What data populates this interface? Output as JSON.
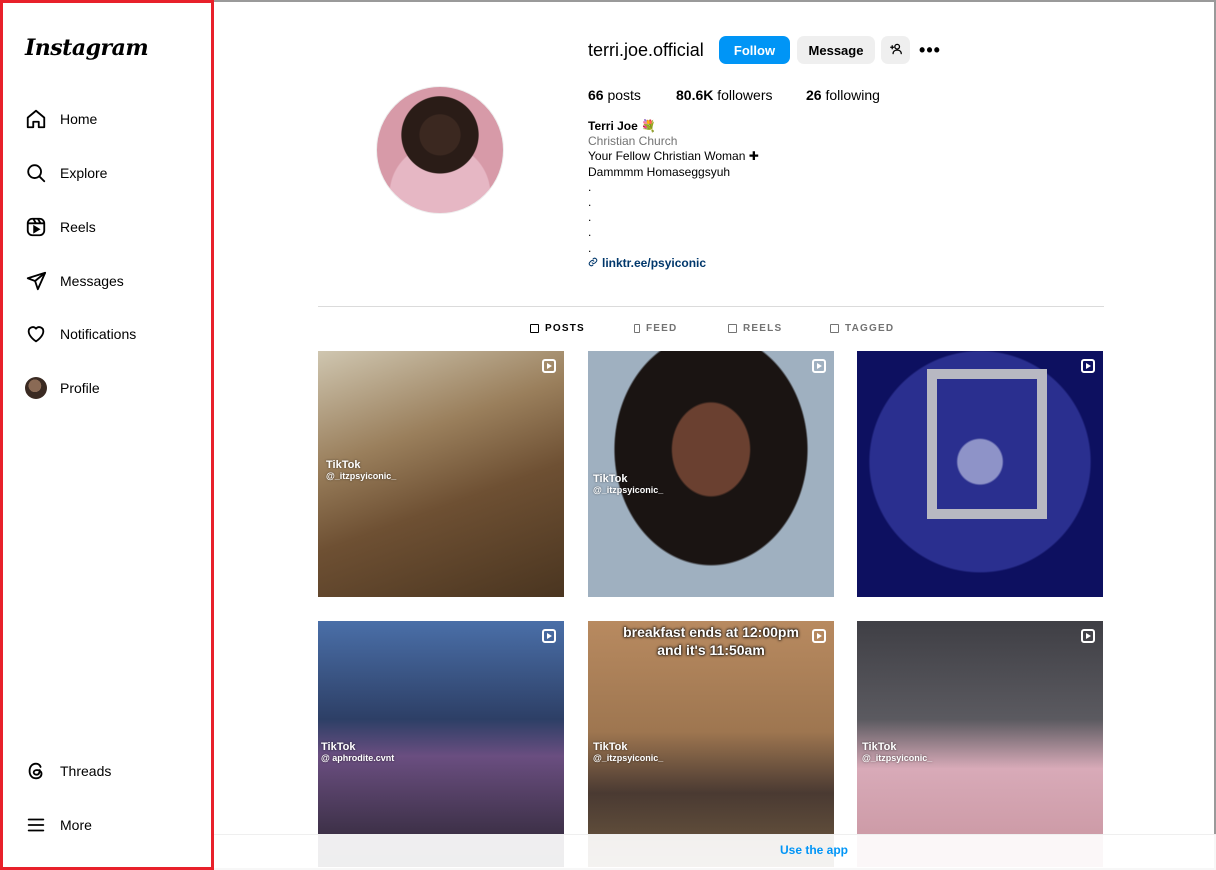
{
  "sidebar": {
    "logo": "Instagram",
    "items": [
      {
        "label": "Home",
        "icon": "home-icon"
      },
      {
        "label": "Explore",
        "icon": "search-icon"
      },
      {
        "label": "Reels",
        "icon": "reels-icon"
      },
      {
        "label": "Messages",
        "icon": "paper-plane-icon"
      },
      {
        "label": "Notifications",
        "icon": "heart-icon"
      },
      {
        "label": "Profile",
        "icon": "avatar"
      }
    ],
    "bottom_items": [
      {
        "label": "Threads",
        "icon": "threads-icon"
      },
      {
        "label": "More",
        "icon": "menu-icon"
      }
    ],
    "highlight_color": "#e8202a"
  },
  "profile": {
    "username": "terri.joe.official",
    "follow_label": "Follow",
    "message_label": "Message",
    "stats": {
      "posts_count": "66",
      "posts_label": "posts",
      "followers_count": "80.6K",
      "followers_label": "followers",
      "following_count": "26",
      "following_label": "following"
    },
    "bio": {
      "name": "Terri Joe 💐",
      "category": "Christian Church",
      "line1": "Your Fellow Christian Woman ✚",
      "line2": "Dammmm Homaseggsyuh",
      "dots": [
        ".",
        ".",
        ".",
        ".",
        "."
      ],
      "link": "linktr.ee/psyiconic"
    }
  },
  "tabs": [
    "POSTS",
    "FEED",
    "REELS",
    "TAGGED"
  ],
  "active_tab": "POSTS",
  "grid": {
    "tiles": [
      {
        "tiktok": "TikTok",
        "handle": "@_itzpsyiconic_"
      },
      {
        "tiktok": "TikTok",
        "handle": "@_itzpsyiconic_"
      },
      {
        "tiktok": "",
        "handle": ""
      },
      {
        "tiktok": "TikTok",
        "handle": "@ aphrodite.cvnt"
      },
      {
        "tiktok": "TikTok",
        "handle": "@_itzpsyiconic_",
        "caption1": "breakfast ends at 12:00pm",
        "caption2": "and it's 11:50am"
      },
      {
        "tiktok": "TikTok",
        "handle": "@_itzpsyiconic_"
      }
    ]
  },
  "footer": {
    "use_app": "Use the app"
  },
  "colors": {
    "accent": "#0095f6",
    "link": "#00376b",
    "muted": "#737373"
  }
}
